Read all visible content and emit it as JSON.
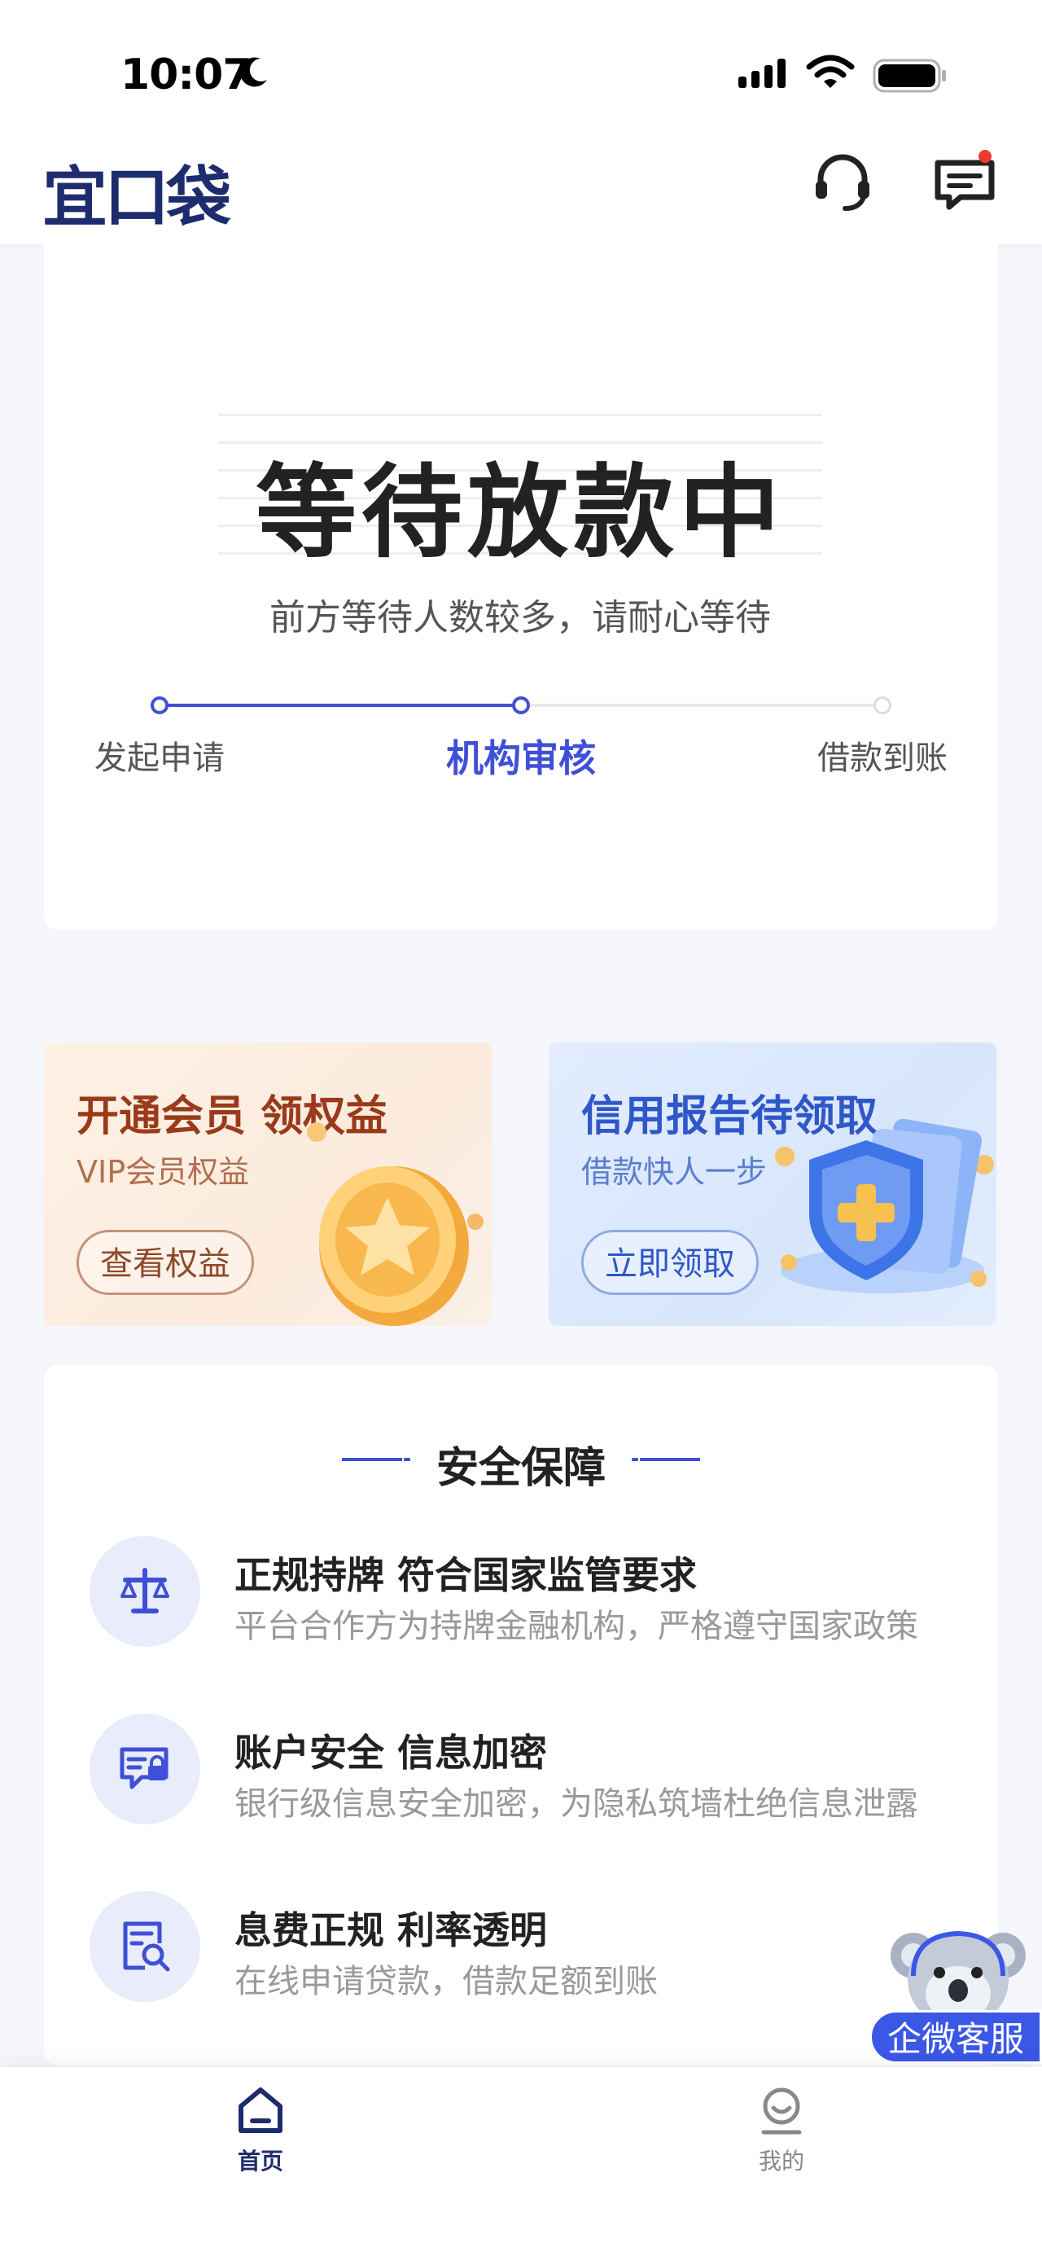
{
  "status_bar": {
    "time": "10:07"
  },
  "header": {
    "logo_text": "宜口袋",
    "support_icon": "headset-icon",
    "message_icon": "message-icon"
  },
  "loan_status": {
    "title": "等待放款中",
    "subtitle": "前方等待人数较多，请耐心等待",
    "steps": [
      {
        "label": "发起申请",
        "state": "done"
      },
      {
        "label": "机构审核",
        "state": "current"
      },
      {
        "label": "借款到账",
        "state": "pending"
      }
    ]
  },
  "promos": [
    {
      "title": "开通会员 领权益",
      "subtitle": "VIP会员权益",
      "button": "查看权益",
      "icon": "gold-coin-icon"
    },
    {
      "title": "信用报告待领取",
      "subtitle": "借款快人一步",
      "button": "立即领取",
      "icon": "shield-icon"
    }
  ],
  "security": {
    "title": "安全保障",
    "features": [
      {
        "title": "正规持牌 符合国家监管要求",
        "desc": "平台合作方为持牌金融机构，严格遵守国家政策",
        "icon": "balance-scale-icon"
      },
      {
        "title": "账户安全 信息加密",
        "desc": "银行级信息安全加密，为隐私筑墙杜绝信息泄露",
        "icon": "secure-card-icon"
      },
      {
        "title": "息费正规  利率透明",
        "desc": "在线申请贷款，借款足额到账",
        "icon": "document-search-icon"
      }
    ]
  },
  "floating_support": {
    "label": "企微客服"
  },
  "tabbar": {
    "tabs": [
      {
        "label": "首页",
        "active": true
      },
      {
        "label": "我的",
        "active": false
      }
    ]
  },
  "colors": {
    "primary": "#3F50D6",
    "brand_navy": "#1E2C6E",
    "vip_brown": "#9A3A1A",
    "credit_blue": "#2F57C9",
    "notification_red": "#F03A2E"
  }
}
